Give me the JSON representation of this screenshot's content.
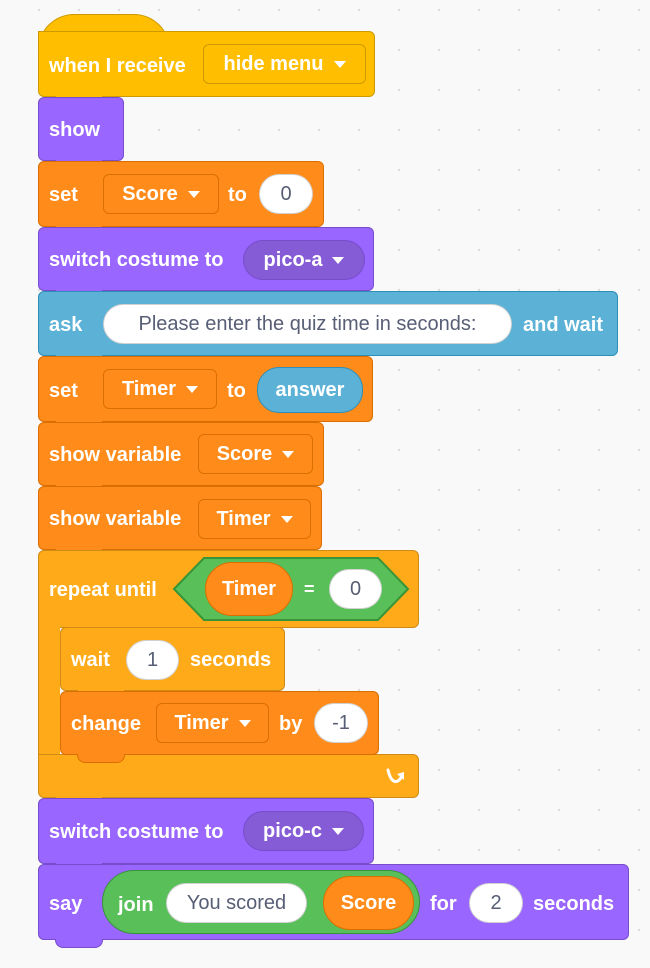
{
  "colors": {
    "events": "#ffbf00",
    "looks": "#9966ff",
    "variables": "#ff8c1a",
    "sensing": "#5cb1d6",
    "control": "#ffab19",
    "operators": "#59c059"
  },
  "blocks": {
    "hat": {
      "label": "when I receive",
      "message": "hide menu"
    },
    "show": {
      "label": "show"
    },
    "set_score": {
      "label": "set",
      "variable": "Score",
      "to": "to",
      "value": "0"
    },
    "switch_costume_1": {
      "label": "switch costume to",
      "costume": "pico-a"
    },
    "ask": {
      "label": "ask",
      "question": "Please enter the quiz time in seconds:",
      "suffix": "and wait"
    },
    "set_timer": {
      "label": "set",
      "variable": "Timer",
      "to": "to",
      "value": "answer"
    },
    "show_variable_score": {
      "label": "show variable",
      "variable": "Score"
    },
    "show_variable_timer": {
      "label": "show variable",
      "variable": "Timer"
    },
    "repeat_until": {
      "label": "repeat until",
      "left": "Timer",
      "op": "=",
      "right": "0",
      "loop_icon": "loop-arrow-icon"
    },
    "wait": {
      "label": "wait",
      "value": "1",
      "unit": "seconds"
    },
    "change_timer": {
      "label": "change",
      "variable": "Timer",
      "by": "by",
      "value": "-1"
    },
    "switch_costume_2": {
      "label": "switch costume to",
      "costume": "pico-c"
    },
    "say": {
      "label": "say",
      "join": "join",
      "text": "You scored",
      "reporter": "Score",
      "for": "for",
      "value": "2",
      "unit": "seconds"
    }
  }
}
